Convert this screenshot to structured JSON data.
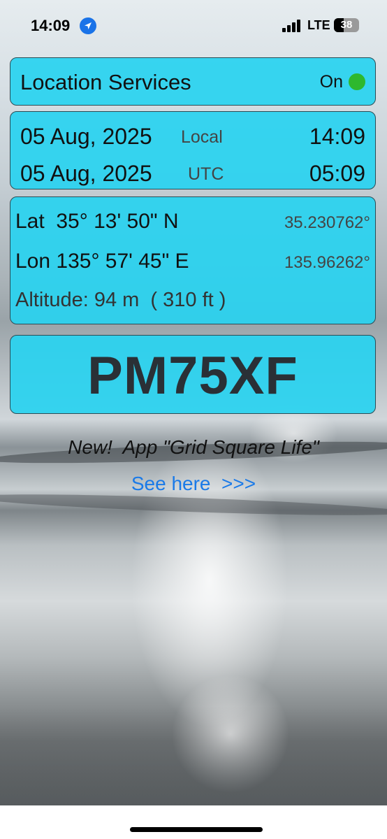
{
  "status_bar": {
    "time": "14:09",
    "network": "LTE",
    "battery": "38"
  },
  "location_services": {
    "label": "Location Services",
    "value": "On",
    "indicator_color": "#2eb82e"
  },
  "datetime": {
    "local": {
      "date": "05 Aug, 2025",
      "zone": "Local",
      "time": "14:09"
    },
    "utc": {
      "date": "05 Aug, 2025",
      "zone": "UTC",
      "time": "05:09"
    }
  },
  "position": {
    "lat": {
      "dms": "Lat  35° 13' 50\" N",
      "decimal": "35.230762°"
    },
    "lon": {
      "dms": "Lon 135° 57' 45\" E",
      "decimal": "135.96262°"
    },
    "altitude": "Altitude: 94 m  ( 310 ft )"
  },
  "grid_square": "PM75XF",
  "promo": {
    "text": "New!  App \"Grid Square Life\"",
    "link": "See here  >>>"
  },
  "colors": {
    "card_background": "#28d2f0",
    "link": "#1a7ae8"
  }
}
